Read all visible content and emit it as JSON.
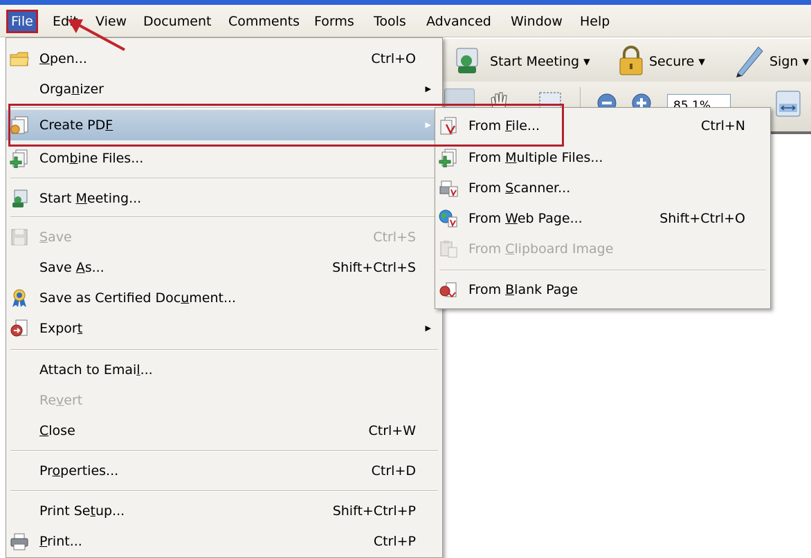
{
  "menubar": {
    "items": [
      "File",
      "Edit",
      "View",
      "Document",
      "Comments",
      "Forms",
      "Tools",
      "Advanced",
      "Window",
      "Help"
    ],
    "selected": "File"
  },
  "toolbar": {
    "start_meeting": "Start Meeting",
    "secure": "Secure",
    "sign": "Sign",
    "zoom": "85.1%"
  },
  "file_menu": {
    "open": {
      "pre": "",
      "u": "O",
      "post": "pen...",
      "shortcut": "Ctrl+O"
    },
    "organizer": {
      "pre": "Orga",
      "u": "n",
      "post": "izer"
    },
    "create_pdf": {
      "pre": "Create PD",
      "u": "F",
      "post": ""
    },
    "combine": {
      "pre": "Com",
      "u": "b",
      "post": "ine Files..."
    },
    "start_meeting": {
      "pre": "Start ",
      "u": "M",
      "post": "eeting..."
    },
    "save": {
      "pre": "",
      "u": "S",
      "post": "ave",
      "shortcut": "Ctrl+S"
    },
    "save_as": {
      "pre": "Save ",
      "u": "A",
      "post": "s...",
      "shortcut": "Shift+Ctrl+S"
    },
    "certified": {
      "pre": "Save as Certified Doc",
      "u": "u",
      "post": "ment..."
    },
    "export": {
      "pre": "Expor",
      "u": "t",
      "post": ""
    },
    "attach": {
      "pre": "Attach to Emai",
      "u": "l",
      "post": "..."
    },
    "revert": {
      "pre": "Re",
      "u": "v",
      "post": "ert"
    },
    "close": {
      "pre": "",
      "u": "C",
      "post": "lose",
      "shortcut": "Ctrl+W"
    },
    "properties": {
      "pre": "Pr",
      "u": "o",
      "post": "perties...",
      "shortcut": "Ctrl+D"
    },
    "print_setup": {
      "pre": "Print Se",
      "u": "t",
      "post": "up...",
      "shortcut": "Shift+Ctrl+P"
    },
    "print": {
      "pre": "",
      "u": "P",
      "post": "rint...",
      "shortcut": "Ctrl+P"
    }
  },
  "submenu": {
    "from_file": {
      "pre": "From ",
      "u": "F",
      "post": "ile...",
      "shortcut": "Ctrl+N"
    },
    "from_multiple": {
      "pre": "From ",
      "u": "M",
      "post": "ultiple Files..."
    },
    "from_scanner": {
      "pre": "From ",
      "u": "S",
      "post": "canner..."
    },
    "from_web": {
      "pre": "From ",
      "u": "W",
      "post": "eb Page...",
      "shortcut": "Shift+Ctrl+O"
    },
    "from_clipboard": {
      "pre": "From ",
      "u": "C",
      "post": "lipboard Image"
    },
    "from_blank": {
      "pre": "From ",
      "u": "B",
      "post": "lank Page"
    }
  },
  "colors": {
    "menu_bg": "#f3f2ee",
    "highlight": "#b6c9dd",
    "annotation_red": "#b3212e",
    "menubar_selected": "#3b5fb5"
  }
}
